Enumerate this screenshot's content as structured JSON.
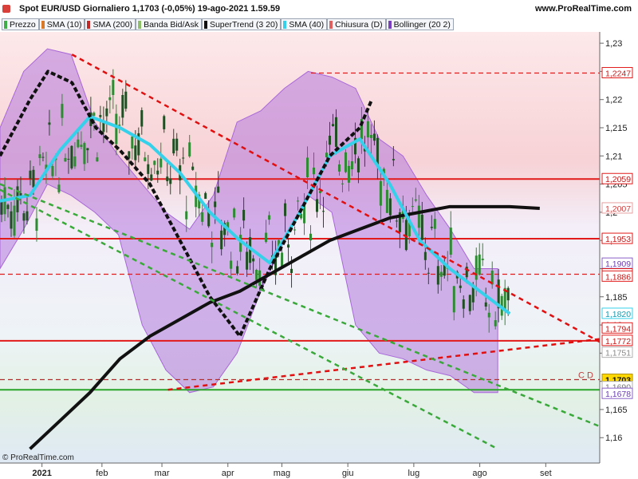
{
  "header": {
    "title": "Spot EUR/USD Giornaliero 1,1703 (-0,05%) 19-ago-2021 1.59.59",
    "brand": "www.ProRealTime.com",
    "watermark": "© ProRealTime.com"
  },
  "legend": [
    {
      "label": "Prezzo",
      "color": "#3fae49"
    },
    {
      "label": "SMA (10)",
      "color": "#d97a2b"
    },
    {
      "label": "SMA (200)",
      "color": "#c22a2a"
    },
    {
      "label": "Banda Bid/Ask",
      "color": "#8fbf6a"
    },
    {
      "label": "SuperTrend (3 20)",
      "color": "#111111"
    },
    {
      "label": "SMA (40)",
      "color": "#35d0ea"
    },
    {
      "label": "Chiusura (D)",
      "color": "#e06060"
    },
    {
      "label": "Bollinger (20 2)",
      "color": "#7a3fbf"
    }
  ],
  "chart_data": {
    "type": "line",
    "instrument": "Spot EUR/USD",
    "y_ticks": [
      "1,23",
      "1,225",
      "1,22",
      "1,215",
      "1,21",
      "1,205",
      "1,2",
      "1,195",
      "1,19",
      "1,185",
      "1,18",
      "1,175",
      "1,17",
      "1,165",
      "1,16"
    ],
    "ylim": [
      1.1555,
      1.232
    ],
    "x_ticks": [
      "2021",
      "feb",
      "mar",
      "apr",
      "mag",
      "giu",
      "lug",
      "ago",
      "set"
    ],
    "horizontal_levels": [
      {
        "value": 1.2247,
        "label": "1,2247",
        "color": "#e21a1a",
        "style": "dashed"
      },
      {
        "value": 1.2059,
        "label": "1,2059",
        "color": "#e21a1a",
        "style": "solid"
      },
      {
        "value": 1.1953,
        "label": "1,1953",
        "color": "#e21a1a",
        "style": "solid"
      },
      {
        "value": 1.189,
        "label": "1,1890",
        "color": "#e21a1a",
        "style": "dashed"
      },
      {
        "value": 1.1772,
        "label": "1,1772",
        "color": "#e21a1a",
        "style": "solid"
      },
      {
        "value": 1.1703,
        "label": "1,1703",
        "color": "#b03030",
        "style": "dashed"
      },
      {
        "value": 1.1685,
        "label": "",
        "color": "#2aa52a",
        "style": "solid"
      }
    ],
    "right_labels": [
      {
        "value": 1.2247,
        "label": "1,2247",
        "bg": "#ffffff",
        "border": "#e21a1a",
        "color": "#c21a1a"
      },
      {
        "value": 1.2059,
        "label": "1,2059",
        "bg": "#ffffff",
        "border": "#e21a1a",
        "color": "#c21a1a"
      },
      {
        "value": 1.2007,
        "label": "1,2007",
        "bg": "#ffffff",
        "border": "#e8a0a0",
        "color": "#d04040"
      },
      {
        "value": 1.1953,
        "label": "1,1953",
        "bg": "#ffffff",
        "border": "#e21a1a",
        "color": "#c21a1a"
      },
      {
        "value": 1.1909,
        "label": "1,1909",
        "bg": "#ffffff",
        "border": "#8a60c8",
        "color": "#6a3fb0"
      },
      {
        "value": 1.189,
        "label": "1,1890",
        "bg": "#ffffff",
        "border": "#e21a1a",
        "color": "#c21a1a"
      },
      {
        "value": 1.1886,
        "label": "1,1886",
        "bg": "#ffffff",
        "border": "#e21a1a",
        "color": "#c21a1a"
      },
      {
        "value": 1.182,
        "label": "1,1820",
        "bg": "#ffffff",
        "border": "#35d0ea",
        "color": "#1a9ab0"
      },
      {
        "value": 1.1794,
        "label": "1,1794",
        "bg": "#ffffff",
        "border": "#e21a1a",
        "color": "#c21a1a"
      },
      {
        "value": 1.1772,
        "label": "1,1772",
        "bg": "#ffffff",
        "border": "#e21a1a",
        "color": "#c21a1a"
      },
      {
        "value": 1.1751,
        "label": "1,1751",
        "bg": "#ffffff",
        "border": "#b0b0b0",
        "color": "#888888"
      },
      {
        "value": 1.1703,
        "label": "1,1703",
        "bg": "#ffd800",
        "border": "#b09000",
        "color": "#111111"
      },
      {
        "value": 1.169,
        "label": "1,1690",
        "bg": "#ffffff",
        "border": "#b0b0b0",
        "color": "#777777"
      },
      {
        "value": 1.1678,
        "label": "1,1678",
        "bg": "#ffffff",
        "border": "#8a60c8",
        "color": "#6a3fb0"
      }
    ],
    "annotation": "C D",
    "series": [
      {
        "name": "SMA (200)",
        "color": "#111111",
        "x": [
          0.05,
          0.1,
          0.15,
          0.2,
          0.25,
          0.3,
          0.35,
          0.4,
          0.45,
          0.5,
          0.55,
          0.6,
          0.65,
          0.7,
          0.75,
          0.8,
          0.85,
          0.9
        ],
        "values": [
          1.158,
          1.163,
          1.168,
          1.174,
          1.178,
          1.181,
          1.184,
          1.186,
          1.189,
          1.192,
          1.195,
          1.197,
          1.199,
          1.2,
          1.201,
          1.201,
          1.201,
          1.2007
        ]
      },
      {
        "name": "SMA (40)",
        "color": "#35d0ea",
        "x": [
          0,
          0.05,
          0.1,
          0.15,
          0.2,
          0.25,
          0.3,
          0.35,
          0.4,
          0.45,
          0.5,
          0.55,
          0.6,
          0.65,
          0.7,
          0.75,
          0.8,
          0.85
        ],
        "values": [
          1.202,
          1.203,
          1.211,
          1.217,
          1.215,
          1.212,
          1.207,
          1.2,
          1.195,
          1.191,
          1.2,
          1.21,
          1.213,
          1.205,
          1.195,
          1.19,
          1.186,
          1.182
        ]
      },
      {
        "name": "SuperTrend (3 20)",
        "color": "#111111",
        "x": [
          0,
          0.05,
          0.08,
          0.12,
          0.16,
          0.2,
          0.25,
          0.3,
          0.35,
          0.4,
          0.45,
          0.5,
          0.55,
          0.6,
          0.62
        ],
        "values": [
          1.21,
          1.22,
          1.225,
          1.223,
          1.215,
          1.211,
          1.205,
          1.195,
          1.185,
          1.178,
          1.19,
          1.2,
          1.21,
          1.215,
          1.22
        ]
      }
    ],
    "bollinger_band": {
      "upper": [
        1.215,
        1.225,
        1.229,
        1.228,
        1.216,
        1.21,
        1.205,
        1.2,
        1.197,
        1.203,
        1.216,
        1.218,
        1.222,
        1.225,
        1.224,
        1.222,
        1.213,
        1.21,
        1.203,
        1.197,
        1.19,
        1.19
      ],
      "lower": [
        1.19,
        1.197,
        1.205,
        1.203,
        1.2,
        1.196,
        1.18,
        1.172,
        1.168,
        1.169,
        1.175,
        1.186,
        1.195,
        1.203,
        1.2,
        1.18,
        1.175,
        1.174,
        1.172,
        1.171,
        1.168,
        1.168
      ],
      "color": "#a868d8"
    },
    "trendlines": [
      {
        "name": "downtrend-red",
        "color": "#e01010",
        "style": "dashed",
        "from": [
          0.12,
          1.228
        ],
        "to": [
          1.0,
          1.177
        ]
      },
      {
        "name": "uptrend-red",
        "color": "#e01010",
        "style": "dashed",
        "from": [
          0.28,
          1.1685
        ],
        "to": [
          1.0,
          1.1775
        ]
      },
      {
        "name": "downtrend-green-lower",
        "color": "#3aa83a",
        "style": "dashed",
        "from": [
          0.0,
          1.204
        ],
        "to": [
          0.83,
          1.158
        ]
      },
      {
        "name": "downtrend-green-upper",
        "color": "#3aa83a",
        "style": "dashed",
        "from": [
          0.0,
          1.205
        ],
        "to": [
          1.0,
          1.162
        ]
      }
    ]
  }
}
